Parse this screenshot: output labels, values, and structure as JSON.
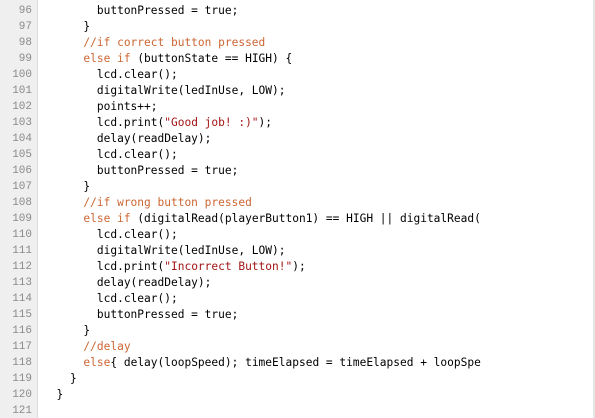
{
  "editor": {
    "line_numbers": [
      "96",
      "97",
      "98",
      "99",
      "100",
      "101",
      "102",
      "103",
      "104",
      "105",
      "106",
      "107",
      "108",
      "109",
      "110",
      "111",
      "112",
      "113",
      "114",
      "115",
      "116",
      "117",
      "118",
      "119",
      "120",
      "121"
    ],
    "lines": [
      [
        {
          "t": "        buttonPressed = true;",
          "c": ""
        }
      ],
      [
        {
          "t": "      }",
          "c": ""
        }
      ],
      [
        {
          "t": "      //if correct button pressed",
          "c": "cm"
        }
      ],
      [
        {
          "t": "      ",
          "c": ""
        },
        {
          "t": "else if",
          "c": "kw"
        },
        {
          "t": " (buttonState == HIGH) {",
          "c": ""
        }
      ],
      [
        {
          "t": "        lcd.clear();",
          "c": ""
        }
      ],
      [
        {
          "t": "        digitalWrite(ledInUse, LOW);",
          "c": ""
        }
      ],
      [
        {
          "t": "        points++;",
          "c": ""
        }
      ],
      [
        {
          "t": "        lcd.print(",
          "c": ""
        },
        {
          "t": "\"Good job! :)\"",
          "c": "st"
        },
        {
          "t": ");",
          "c": ""
        }
      ],
      [
        {
          "t": "        delay(readDelay);",
          "c": ""
        }
      ],
      [
        {
          "t": "        lcd.clear();",
          "c": ""
        }
      ],
      [
        {
          "t": "        buttonPressed = true;",
          "c": ""
        }
      ],
      [
        {
          "t": "      }",
          "c": ""
        }
      ],
      [
        {
          "t": "      //if wrong button pressed",
          "c": "cm"
        }
      ],
      [
        {
          "t": "      ",
          "c": ""
        },
        {
          "t": "else if",
          "c": "kw"
        },
        {
          "t": " (digitalRead(playerButton1) == HIGH || digitalRead(",
          "c": ""
        }
      ],
      [
        {
          "t": "        lcd.clear();",
          "c": ""
        }
      ],
      [
        {
          "t": "        digitalWrite(ledInUse, LOW);",
          "c": ""
        }
      ],
      [
        {
          "t": "        lcd.print(",
          "c": ""
        },
        {
          "t": "\"Incorrect Button!\"",
          "c": "st"
        },
        {
          "t": ");",
          "c": ""
        }
      ],
      [
        {
          "t": "        delay(readDelay);",
          "c": ""
        }
      ],
      [
        {
          "t": "        lcd.clear();",
          "c": ""
        }
      ],
      [
        {
          "t": "        buttonPressed = true;",
          "c": ""
        }
      ],
      [
        {
          "t": "      }",
          "c": ""
        }
      ],
      [
        {
          "t": "      //delay",
          "c": "cm"
        }
      ],
      [
        {
          "t": "      ",
          "c": ""
        },
        {
          "t": "else",
          "c": "kw"
        },
        {
          "t": "{ delay(loopSpeed); timeElapsed = timeElapsed + loopSpe",
          "c": ""
        }
      ],
      [
        {
          "t": "    }",
          "c": ""
        }
      ],
      [
        {
          "t": "  }",
          "c": ""
        }
      ],
      [
        {
          "t": "",
          "c": ""
        }
      ]
    ]
  },
  "colors": {
    "keyword": "#cc6633",
    "comment": "#cc6633",
    "string": "#a31515",
    "gutter_bg": "#efefef",
    "line_number": "#8a8a8a"
  }
}
